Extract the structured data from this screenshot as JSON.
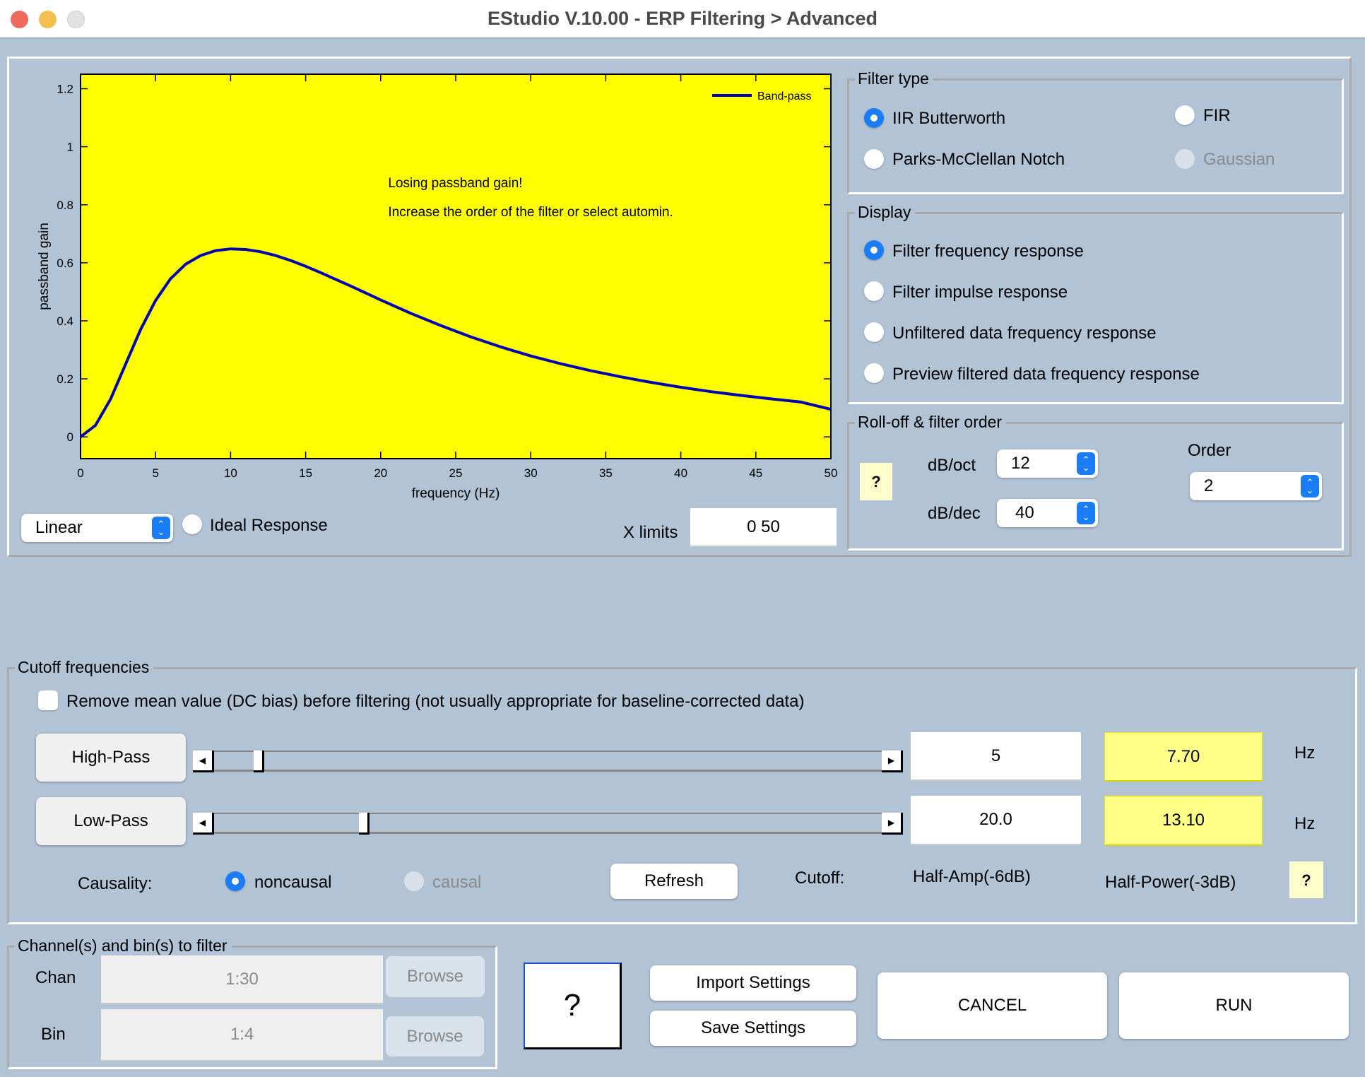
{
  "window": {
    "title": "EStudio V.10.00  -  ERP Filtering > Advanced",
    "traffic_lights": {
      "close": "#ec6a5e",
      "minimize": "#f4bf4f",
      "zoom": "#e2e2e2"
    }
  },
  "plot": {
    "legend_label": "Band-pass",
    "annotation_line1": "Losing passband gain!",
    "annotation_line2": "Increase the order of the filter or select automin.",
    "scale_select": "Linear",
    "ideal_response_label": "Ideal Response",
    "ideal_response_checked": false,
    "xlimits_label": "X limits",
    "xlimits_value": "0  50"
  },
  "chart_data": {
    "type": "line",
    "title": "",
    "xlabel": "frequency (Hz)",
    "ylabel": "passband gain",
    "xlim": [
      0,
      50
    ],
    "ylim": [
      -0.075,
      1.25
    ],
    "xticks": [
      0,
      5,
      10,
      15,
      20,
      25,
      30,
      35,
      40,
      45,
      50
    ],
    "yticks": [
      0,
      0.2,
      0.4,
      0.6,
      0.8,
      1,
      1.2
    ],
    "ytick_labels": [
      "0",
      "0.2",
      "0.4",
      "0.6",
      "0.8",
      "1",
      "1.2"
    ],
    "grid": false,
    "background": "#ffff00",
    "legend_position": "top-right",
    "series": [
      {
        "name": "Band-pass",
        "color": "#0000b4",
        "x": [
          0,
          1,
          2,
          3,
          4,
          5,
          6,
          7,
          8,
          9,
          10,
          11,
          12,
          13,
          14,
          15,
          16,
          17,
          18,
          19,
          20,
          22,
          24,
          26,
          28,
          30,
          32,
          34,
          36,
          38,
          40,
          42,
          44,
          46,
          48,
          50
        ],
        "y": [
          0.0,
          0.04,
          0.13,
          0.25,
          0.37,
          0.47,
          0.545,
          0.595,
          0.625,
          0.642,
          0.648,
          0.646,
          0.638,
          0.625,
          0.608,
          0.588,
          0.566,
          0.543,
          0.52,
          0.496,
          0.472,
          0.426,
          0.384,
          0.345,
          0.31,
          0.279,
          0.252,
          0.228,
          0.207,
          0.188,
          0.171,
          0.156,
          0.143,
          0.131,
          0.12,
          0.095
        ]
      }
    ]
  },
  "filter_type": {
    "title": "Filter type",
    "options": [
      {
        "label": "IIR Butterworth",
        "selected": true,
        "enabled": true
      },
      {
        "label": "FIR",
        "selected": false,
        "enabled": true
      },
      {
        "label": "Parks-McClellan Notch",
        "selected": false,
        "enabled": true
      },
      {
        "label": "Gaussian",
        "selected": false,
        "enabled": false
      }
    ]
  },
  "display": {
    "title": "Display",
    "options": [
      {
        "label": "Filter frequency response",
        "selected": true
      },
      {
        "label": "Filter impulse response",
        "selected": false
      },
      {
        "label": "Unfiltered data frequency response",
        "selected": false
      },
      {
        "label": "Preview filtered data frequency response",
        "selected": false
      }
    ]
  },
  "rolloff": {
    "title": "Roll-off & filter order",
    "help": "?",
    "db_oct_label": "dB/oct",
    "db_oct_value": "12",
    "db_dec_label": "dB/dec",
    "db_dec_value": "40",
    "order_label": "Order",
    "order_value": "2"
  },
  "cutoff": {
    "title": "Cutoff frequencies",
    "dc_bias_label": "Remove mean value (DC bias) before filtering (not usually appropriate for baseline-corrected data)",
    "dc_bias_checked": false,
    "highpass": {
      "button": "High-Pass",
      "value": "5",
      "half_power": "7.70",
      "unit": "Hz",
      "slider_fraction": 0.06
    },
    "lowpass": {
      "button": "Low-Pass",
      "value": "20.0",
      "half_power": "13.10",
      "unit": "Hz",
      "slider_fraction": 0.22
    },
    "causality_label": "Causality:",
    "noncausal_label": "noncausal",
    "noncausal_selected": true,
    "causal_label": "causal",
    "causal_enabled": false,
    "refresh_label": "Refresh",
    "cutoff_label": "Cutoff:",
    "half_amp_label": "Half-Amp(-6dB)",
    "half_power_label": "Half-Power(-3dB)",
    "help": "?"
  },
  "channels": {
    "title": "Channel(s)  and bin(s) to filter",
    "chan_label": "Chan",
    "chan_value": "1:30",
    "bin_label": "Bin",
    "bin_value": "1:4",
    "browse_label": "Browse"
  },
  "footer": {
    "help": "?",
    "import_label": "Import Settings",
    "save_label": "Save Settings",
    "cancel_label": "CANCEL",
    "run_label": "RUN"
  }
}
